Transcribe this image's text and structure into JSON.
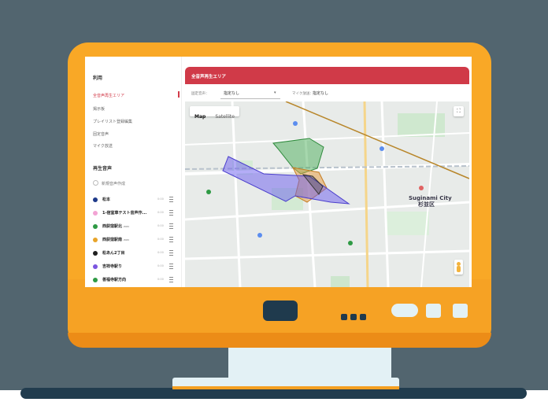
{
  "sidebar": {
    "title": "利用",
    "menu": [
      {
        "label": "全音声再生エリア",
        "active": true
      },
      {
        "label": "掲示板"
      },
      {
        "label": "プレイリスト登録編集"
      },
      {
        "label": "固定音声"
      },
      {
        "label": "マイク放送"
      }
    ],
    "section_title": "再生音声",
    "add_label": "新規音声作成",
    "tracks": [
      {
        "name": "松本",
        "suffix": "",
        "duration": "0:00",
        "color": "#1e3a8a"
      },
      {
        "name": "1-宿室車テスト音声作...",
        "suffix": "",
        "duration": "0:00",
        "color": "#f2a3d4"
      },
      {
        "name": "西荻窪駅北",
        "suffix": ".wav",
        "duration": "0:00",
        "color": "#2e9a44"
      },
      {
        "name": "西荻窪駅南",
        "suffix": ".wav",
        "duration": "0:00",
        "color": "#e8a42a"
      },
      {
        "name": "松あん2丁目",
        "suffix": "",
        "duration": "0:00",
        "color": "#1f1f1f"
      },
      {
        "name": "吉祥寺駅り",
        "suffix": "",
        "duration": "0:00",
        "color": "#7b55e0"
      },
      {
        "name": "善福寺駅方向",
        "suffix": "",
        "duration": "0:00",
        "color": "#2e9a44"
      }
    ]
  },
  "main": {
    "header_title": "全音声再生エリア",
    "toolbar": {
      "fixed_label": "固定音声：",
      "fixed_value": "指定なし",
      "mic_label": "マイク放送：",
      "mic_value": "指定なし"
    }
  },
  "map": {
    "type_options": [
      "Map",
      "Satellite"
    ],
    "selected_type": "Map",
    "place_name_en": "Suginami City",
    "place_name_ja": "杉並区",
    "polygon_colors": {
      "green": "#3aa64a",
      "purple": "#6a5cf0",
      "orange": "#e89a3c",
      "dark": "#444444",
      "line": "#b8862a"
    }
  }
}
